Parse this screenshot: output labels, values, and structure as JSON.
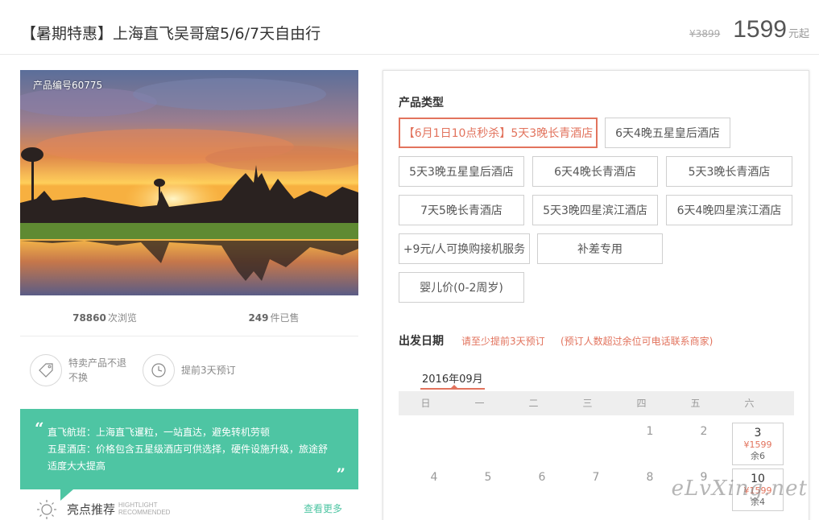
{
  "header": {
    "title": "【暑期特惠】上海直飞吴哥窟5/6/7天自由行",
    "old_price": "¥3899",
    "price": "1599",
    "price_unit": "元起"
  },
  "gallery": {
    "product_no": "产品编号60775"
  },
  "stats": {
    "views_num": "78860",
    "views_label": "次浏览",
    "sold_num": "249",
    "sold_label": "件已售"
  },
  "features": [
    {
      "icon": "tag-icon",
      "text": "特卖产品不退不换"
    },
    {
      "icon": "clock-icon",
      "text": "提前3天预订"
    }
  ],
  "highlight_bubble": {
    "line1": "直飞航班：上海直飞暹粒，一站直达，避免转机劳顿",
    "line2": "五星酒店：价格包含五星级酒店可供选择，硬件设施升级，旅途舒",
    "line3": "适度大大提高"
  },
  "highlight": {
    "title": "亮点推荐",
    "sub1": "HIGHTLIGHT",
    "sub2": "RECOMMENDED",
    "more": "查看更多"
  },
  "product_type": {
    "label": "产品类型",
    "options": [
      "【6月1日10点秒杀】5天3晚长青酒店",
      "6天4晚五星皇后酒店",
      "5天3晚五星皇后酒店",
      "6天4晚长青酒店",
      "5天3晚长青酒店",
      "7天5晚长青酒店",
      "5天3晚四星滨江酒店",
      "6天4晚四星滨江酒店",
      "+9元/人可换购接机服务",
      "补差专用",
      "婴儿价(0-2周岁)"
    ],
    "selected_index": 0
  },
  "departure": {
    "label": "出发日期",
    "note1": "请至少提前3天预订",
    "note2": "(预订人数超过余位可电话联系商家)",
    "month": "2016年09月",
    "weekdays": [
      "日",
      "一",
      "二",
      "三",
      "四",
      "五",
      "六"
    ],
    "days": {
      "d1": "1",
      "d2": "2",
      "d3": "3",
      "d4": "4",
      "d5": "5",
      "d6": "6",
      "d7": "7",
      "d8": "8",
      "d9": "9",
      "d10": "10"
    },
    "d3_price": "¥1599",
    "d3_left": "余6",
    "d10_price": "¥1599",
    "d10_left": "余4"
  },
  "watermark": "eLvXing.net",
  "colors": {
    "accent": "#e2735d",
    "green": "#4ec5a3"
  }
}
